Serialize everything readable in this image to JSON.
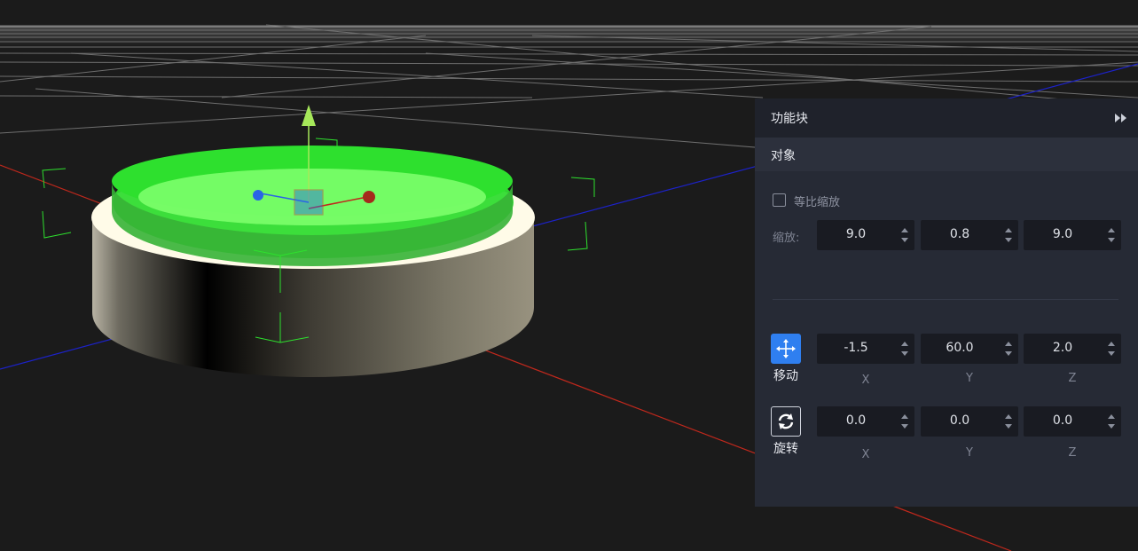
{
  "panel": {
    "title": "功能块",
    "section_title": "对象",
    "uniform_scale_label": "等比缩放",
    "uniform_scale_checked": false,
    "scale_label": "缩放:",
    "scale_values": [
      "9.0",
      "0.8",
      "9.0"
    ],
    "move_label": "移动",
    "move_values": [
      "-1.5",
      "60.0",
      "2.0"
    ],
    "rotate_label": "旋转",
    "rotate_values": [
      "0.0",
      "0.0",
      "0.0"
    ],
    "axis_labels": [
      "X",
      "Y",
      "Z"
    ],
    "icons": {
      "collapse": "double-chevron-right-icon",
      "move": "move-arrows-icon",
      "rotate": "rotate-arrows-icon"
    }
  },
  "colors": {
    "background": "#1b1b1b",
    "panel": "#262a35",
    "accent": "#2f7ff0",
    "x_axis": "#c0281c",
    "z_axis": "#1c22c8",
    "selection": "#2ee02e"
  }
}
